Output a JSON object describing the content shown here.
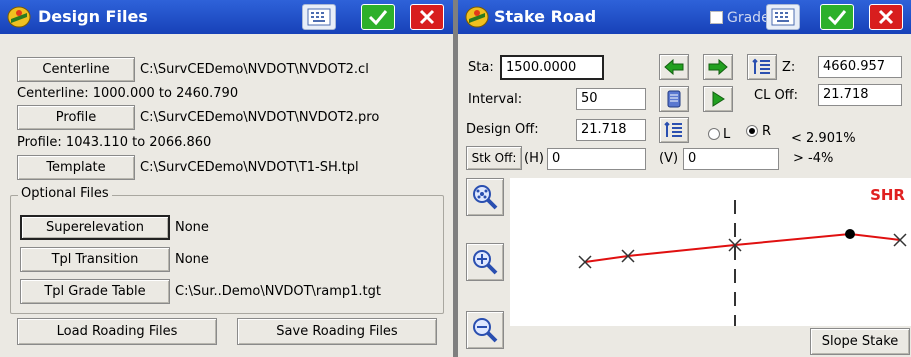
{
  "design_files": {
    "title": "Design Files",
    "centerline": {
      "button": "Centerline",
      "path": "C:\\SurvCEDemo\\NVDOT\\NVDOT2.cl",
      "range": "Centerline: 1000.000 to 2460.790"
    },
    "profile": {
      "button": "Profile",
      "path": "C:\\SurvCEDemo\\NVDOT\\NVDOT2.pro",
      "range": "Profile: 1043.110 to 2066.860"
    },
    "template": {
      "button": "Template",
      "path": "C:\\SurvCEDemo\\NVDOT\\T1-SH.tpl"
    },
    "optional": {
      "label": "Optional Files",
      "superelevation": {
        "button": "Superelevation",
        "value": "None"
      },
      "tpl_transition": {
        "button": "Tpl Transition",
        "value": "None"
      },
      "tpl_grade_table": {
        "button": "Tpl Grade Table",
        "value": "C:\\Sur..Demo\\NVDOT\\ramp1.tgt"
      }
    },
    "load_button": "Load Roading Files",
    "save_button": "Save Roading Files"
  },
  "stake_road": {
    "title": "Stake Road",
    "grade_label": "Grade",
    "sta_label": "Sta:",
    "sta_value": "1500.0000",
    "z_label": "Z:",
    "z_value": "4660.957",
    "interval_label": "Interval:",
    "interval_value": "50",
    "cl_off_label": "CL Off:",
    "cl_off_value": "21.718",
    "design_off_label": "Design Off:",
    "design_off_value": "21.718",
    "radio_l": "L",
    "radio_r": "R",
    "radio_selected": "R",
    "slope_up": "< 2.901%",
    "slope_down": "> -4%",
    "stk_off_label": "Stk Off:",
    "h_label": "(H)",
    "h_value": "0",
    "v_label": "(V)",
    "v_value": "0",
    "shr_label": "SHR",
    "slope_stake_button": "Slope Stake"
  },
  "colors": {
    "titlebar": "#1f4fc8",
    "ok": "#2db02b",
    "cancel": "#d81e1e",
    "arrow_green": "#22a020",
    "section_line": "#e01010",
    "shr": "#e02020"
  }
}
